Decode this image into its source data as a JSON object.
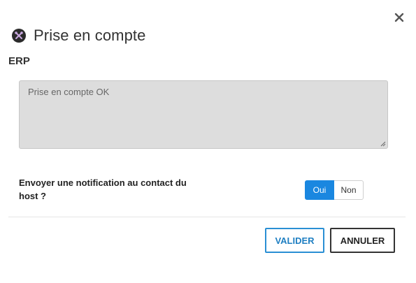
{
  "dialog": {
    "title": "Prise en compte",
    "title_icon": "tools-icon",
    "close_icon": "close-icon"
  },
  "section": {
    "label": "ERP"
  },
  "comment": {
    "value": "Prise en compte OK"
  },
  "notification": {
    "label": "Envoyer une notification au contact du host ?",
    "options": [
      "Oui",
      "Non"
    ],
    "selected": "Oui"
  },
  "actions": {
    "validate_label": "VALIDER",
    "cancel_label": "ANNULER"
  },
  "colors": {
    "accent": "#1a87e0",
    "validate_border": "#2a8fd4",
    "textarea_bg": "#dddddd"
  }
}
